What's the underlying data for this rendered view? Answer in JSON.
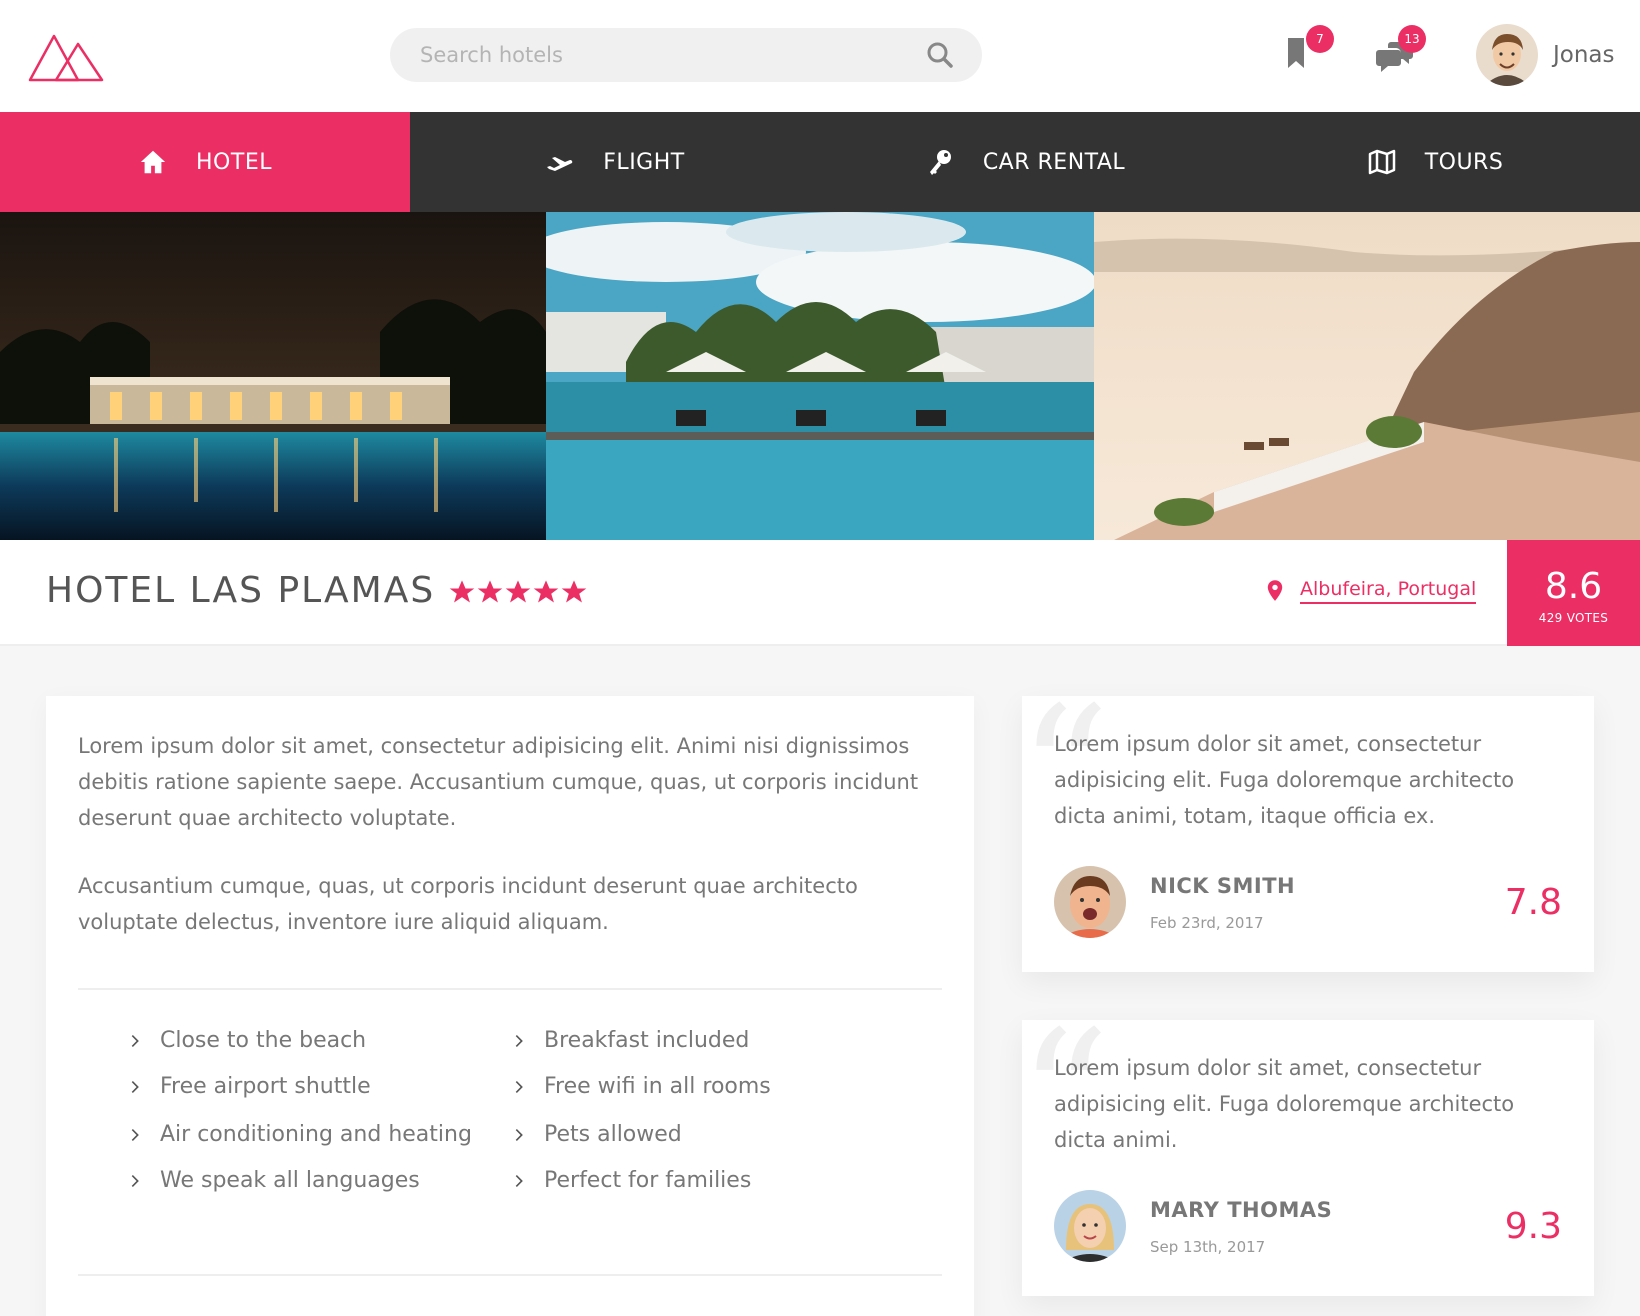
{
  "header": {
    "search_placeholder": "Search hotels",
    "bookmarks_count": "7",
    "messages_count": "13",
    "user_name": "Jonas"
  },
  "nav": {
    "items": [
      {
        "label": "HOTEL",
        "icon": "home-icon",
        "active": true
      },
      {
        "label": "FLIGHT",
        "icon": "airplane-icon",
        "active": false
      },
      {
        "label": "CAR RENTAL",
        "icon": "key-icon",
        "active": false
      },
      {
        "label": "TOURS",
        "icon": "map-icon",
        "active": false
      }
    ]
  },
  "gallery": {
    "photos": [
      "hotel-pool-night-photo",
      "hotel-pool-day-photo",
      "cliffside-terrace-photo"
    ]
  },
  "overview": {
    "hotel_name": "HOTEL LAS PLAMAS",
    "star_count": 5,
    "location": "Albufeira, Portugal",
    "rating_average": "8.6",
    "rating_count": "429 VOTES"
  },
  "description": {
    "paragraph_1": "Lorem ipsum dolor sit amet, consectetur adipisicing elit. Animi nisi dignissimos debitis ratione sapiente saepe. Accusantium cumque, quas, ut corporis incidunt deserunt quae architecto voluptate.",
    "paragraph_2": "Accusantium cumque, quas, ut corporis incidunt deserunt quae architecto voluptate delectus, inventore iure aliquid aliquam.",
    "features": [
      "Close to the beach",
      "Breakfast included",
      "Free airport shuttle",
      "Free wifi in all rooms",
      "Air conditioning and heating",
      "Pets allowed",
      "We speak all languages",
      "Perfect for families"
    ]
  },
  "reviews": [
    {
      "text": "Lorem ipsum dolor sit amet, consectetur adipisicing elit. Fuga doloremque architecto dicta animi, totam, itaque officia ex.",
      "name": "NICK SMITH",
      "date": "Feb 23rd, 2017",
      "score": "7.8"
    },
    {
      "text": "Lorem ipsum dolor sit amet, consectetur adipisicing elit. Fuga doloremque architecto dicta animi.",
      "name": "MARY THOMAS",
      "date": "Sep 13th, 2017",
      "score": "9.3"
    }
  ],
  "colors": {
    "primary": "#eb2f64",
    "nav_background": "#333333",
    "page_background": "#f6f6f6",
    "text": "#777777"
  }
}
